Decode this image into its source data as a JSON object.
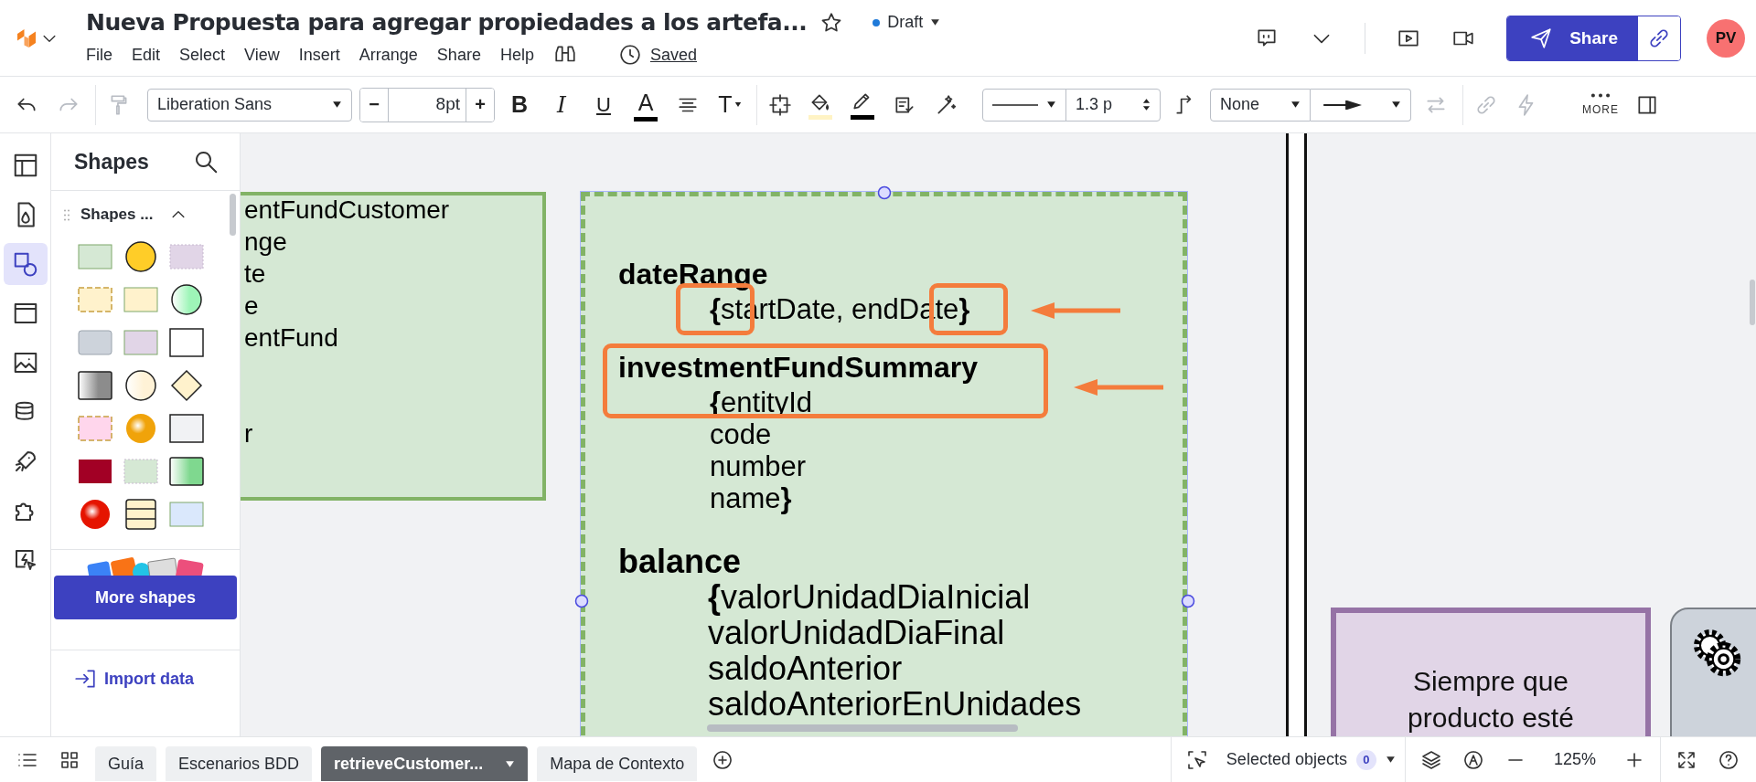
{
  "header": {
    "title": "Nueva Propuesta para agregar propiedades a los artefa...",
    "status": "Draft",
    "save_state": "Saved",
    "share": "Share",
    "avatar": "PV"
  },
  "menu": [
    "File",
    "Edit",
    "Select",
    "View",
    "Insert",
    "Arrange",
    "Share",
    "Help"
  ],
  "toolbar": [
    {
      "kind": "undo",
      "disabled": false
    },
    {
      "kind": "redo",
      "disabled": true
    },
    {
      "kind": "paint",
      "disabled": true
    },
    {
      "kind": "font-select",
      "text": "Liberation Sans"
    },
    {
      "kind": "size-stepper",
      "minus": "−",
      "text": "8pt",
      "plus": "+"
    },
    {
      "kind": "bold",
      "text": "B"
    },
    {
      "kind": "italic",
      "text": "I"
    },
    {
      "kind": "underline",
      "text": "U"
    },
    {
      "kind": "text-color",
      "text": "A"
    },
    {
      "kind": "align",
      "disabled": false
    },
    {
      "kind": "text-style",
      "text": "T"
    },
    {
      "kind": "crop",
      "disabled": false
    },
    {
      "kind": "fill",
      "disabled": false
    },
    {
      "kind": "pen",
      "disabled": false
    },
    {
      "kind": "checklist",
      "disabled": false
    },
    {
      "kind": "wand",
      "disabled": false
    },
    {
      "kind": "line-select"
    },
    {
      "kind": "width-spinner",
      "text": "1.3 p"
    },
    {
      "kind": "connector",
      "disabled": false
    },
    {
      "kind": "arrow-select",
      "text": "None"
    },
    {
      "kind": "swap",
      "disabled": true
    },
    {
      "kind": "link",
      "disabled": true
    },
    {
      "kind": "bolt",
      "disabled": true
    },
    {
      "kind": "more",
      "text": "MORE"
    },
    {
      "kind": "panel",
      "disabled": false
    }
  ],
  "rail": [
    {
      "kind": "layout",
      "selected": false
    },
    {
      "kind": "drop",
      "selected": false
    },
    {
      "kind": "shapes",
      "selected": true
    },
    {
      "kind": "frame",
      "selected": false
    },
    {
      "kind": "image",
      "selected": false
    },
    {
      "kind": "data",
      "selected": false
    },
    {
      "kind": "rocket",
      "selected": false
    },
    {
      "kind": "puzzle",
      "selected": false
    },
    {
      "kind": "action",
      "selected": false
    }
  ],
  "shapes_panel": {
    "title": "Shapes",
    "section": {
      "title": "Shapes ...",
      "expanded": true
    },
    "swatches": [
      {
        "kind": "rect",
        "color": "#d5e8d4"
      },
      {
        "kind": "circle",
        "color": "#ffcd28"
      },
      {
        "kind": "dotted",
        "color": "#e1d5e7"
      },
      {
        "kind": "dashed",
        "color": "#fff2cc"
      },
      {
        "kind": "rect",
        "color": "#fff2cc"
      },
      {
        "kind": "gradient-circle",
        "color": "#9ef5b8"
      },
      {
        "kind": "rounded",
        "color": "#cdd3db"
      },
      {
        "kind": "rect",
        "color": "#e1d5e7"
      },
      {
        "kind": "outline"
      },
      {
        "kind": "gradient",
        "color": "#8c8c8c"
      },
      {
        "kind": "gradient-circle",
        "color": "#fff2d6"
      },
      {
        "kind": "diamond",
        "color": "#fff2cc"
      },
      {
        "kind": "dashed",
        "color": "#ffd6ec"
      },
      {
        "kind": "ball",
        "color": "#f0a30a"
      },
      {
        "kind": "outline",
        "color": "#f1f2f4"
      },
      {
        "kind": "solid",
        "color": "#a20025"
      },
      {
        "kind": "dotted",
        "color": "#d5e8d4"
      },
      {
        "kind": "gradient",
        "color": "#7fd88f"
      },
      {
        "kind": "ball",
        "color": "#e51400"
      },
      {
        "kind": "table",
        "color": "#fff2cc"
      },
      {
        "kind": "rect",
        "color": "#dae8fc"
      }
    ],
    "more": "More shapes",
    "import": "Import data"
  },
  "canvas": {
    "left_shape": {
      "lines": [
        "entFundCustomer",
        "nge",
        "te",
        "e",
        "entFund",
        "r"
      ]
    },
    "selected_shape": {
      "selected": true,
      "blocks": [
        {
          "heading": "dateRange",
          "lines": [
            "**{**startDate, endDate**}**"
          ]
        },
        {
          "heading": "investmentFundSummary",
          "lines": [
            "**{**entityId",
            "code",
            "number",
            "name**}**"
          ]
        },
        {
          "heading": "balance",
          "lines": [
            "**{**valorUnidadDiaInicial",
            "valorUnidadDiaFinal",
            "saldoAnterior",
            "saldoAnteriorEnUnidades"
          ]
        }
      ]
    },
    "note": {
      "text": "Siempre que producto esté"
    }
  },
  "pages": [
    {
      "label": "Guía",
      "selected": false
    },
    {
      "label": "Escenarios BDD",
      "selected": false
    },
    {
      "label": "retrieveCustomer...",
      "selected": true
    },
    {
      "label": "Mapa de Contexto",
      "selected": false
    }
  ],
  "status_bar": {
    "selected_label": "Selected objects",
    "selected_count": "0",
    "zoom": "125%"
  }
}
